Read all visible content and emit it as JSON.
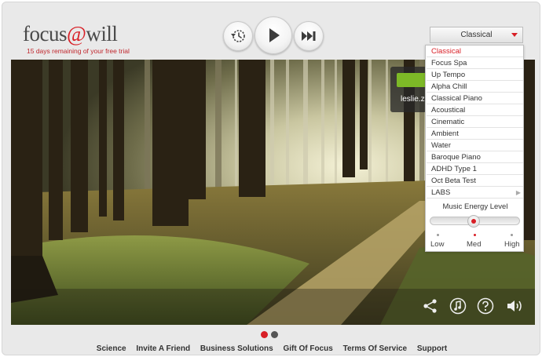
{
  "header": {
    "logo_part1": "focus",
    "logo_at": "@",
    "logo_part2": "will",
    "trial_text": "15 days remaining of your free trial"
  },
  "controls": {
    "history_icon": "history-icon",
    "play_icon": "play-icon",
    "skip_icon": "skip-forward-icon"
  },
  "channel": {
    "selected": "Classical",
    "options": [
      "Classical",
      "Focus Spa",
      "Up Tempo",
      "Alpha Chill",
      "Classical Piano",
      "Acoustical",
      "Cinematic",
      "Ambient",
      "Water",
      "Baroque Piano",
      "ADHD Type 1",
      "Oct Beta Test",
      "LABS"
    ]
  },
  "user": {
    "email_partial": "leslie.z"
  },
  "energy": {
    "title": "Music Energy Level",
    "low": "Low",
    "med": "Med",
    "high": "High",
    "current_level": "Med"
  },
  "bottom_icons": [
    "share-icon",
    "music-note-icon",
    "help-icon",
    "volume-icon"
  ],
  "pager": {
    "active": 0,
    "count": 2
  },
  "footer": {
    "links": [
      "Science",
      "Invite A Friend",
      "Business Solutions",
      "Gift Of Focus",
      "Terms Of Service",
      "Support"
    ]
  },
  "colors": {
    "accent": "#d81f26",
    "green": "#7db927"
  }
}
